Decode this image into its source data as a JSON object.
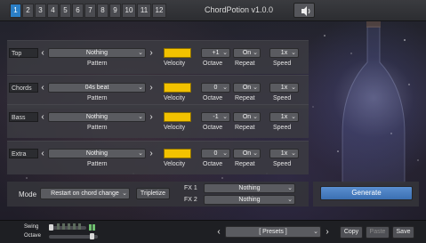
{
  "tabs": [
    "1",
    "2",
    "3",
    "4",
    "5",
    "6",
    "7",
    "8",
    "9",
    "10",
    "11",
    "12"
  ],
  "active_tab": "1",
  "title": "ChordPotion v1.0.0",
  "tracks": [
    {
      "name": "Top",
      "pattern": "Nothing",
      "octave": "+1",
      "repeat": "On",
      "speed": "1x"
    },
    {
      "name": "Chords",
      "pattern": "04s beat",
      "octave": "0",
      "repeat": "On",
      "speed": "1x"
    },
    {
      "name": "Bass",
      "pattern": "Nothing",
      "octave": "-1",
      "repeat": "On",
      "speed": "1x"
    },
    {
      "name": "Extra",
      "pattern": "Nothing",
      "octave": "0",
      "repeat": "On",
      "speed": "1x"
    }
  ],
  "labels": {
    "pattern": "Pattern",
    "velocity": "Velocity",
    "octave": "Octave",
    "repeat": "Repeat",
    "speed": "Speed"
  },
  "arrows": {
    "left": "‹",
    "right": "›",
    "chevron": "⌄"
  },
  "mode": {
    "label": "Mode",
    "value": "Restart on chord change",
    "triplet_button": "Tripletize"
  },
  "fx": {
    "fx1_label": "FX 1",
    "fx1_value": "Nothing",
    "fx2_label": "FX 2",
    "fx2_value": "Nothing"
  },
  "generate_label": "Generate",
  "footer": {
    "swing_label": "Swing",
    "octave_label": "Octave",
    "presets": "[ Presets ]",
    "copy": "Copy",
    "paste": "Paste",
    "save": "Save"
  },
  "colors": {
    "accent": "#2b7fc7",
    "velocity": "#f2c200",
    "generate": "#4a80c3"
  },
  "icons": {
    "speaker": "speaker-icon"
  }
}
